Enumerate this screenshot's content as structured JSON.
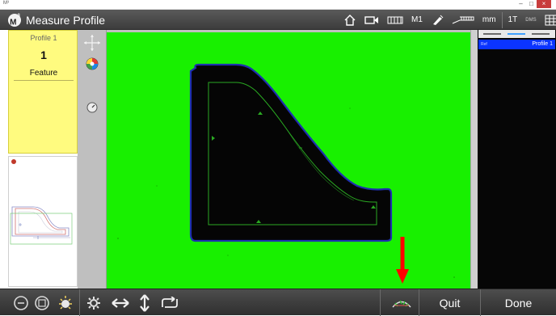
{
  "window": {
    "title": "M³",
    "minimize_glyph": "–",
    "maximize_glyph": "□",
    "close_glyph": "×"
  },
  "header": {
    "logo": "M",
    "logo_sup": "3",
    "title": "Measure Profile",
    "icons": [
      "home-icon",
      "video-icon",
      "grid-icon",
      "probe-icon",
      "ruler-icon"
    ],
    "m1_label": "M1",
    "units": "mm",
    "tool_label": "1T",
    "dms_label": "DMS",
    "help_label": "?"
  },
  "profile": {
    "label": "Profile 1",
    "number": "1",
    "feature_label": "Feature"
  },
  "right_panel": {
    "tab_colors": [
      "#6a6a6a",
      "#3ea0ff",
      "#6a6a6a"
    ],
    "row_tag": "Ref",
    "row_label": "Profile 1"
  },
  "bottom": {
    "quit_label": "Quit",
    "done_label": "Done",
    "icons": [
      "zoom-icon",
      "fit-icon",
      "light-icon",
      "settings-icon",
      "horizontal-arrows-icon",
      "vertical-arrows-icon",
      "rotate-icon",
      "profile-measure-icon"
    ]
  },
  "colors": {
    "canvas": "#18f000",
    "profile_card": "#fffb7f",
    "selection": "#0b34ff",
    "annotation_arrow": "#ff0000"
  }
}
